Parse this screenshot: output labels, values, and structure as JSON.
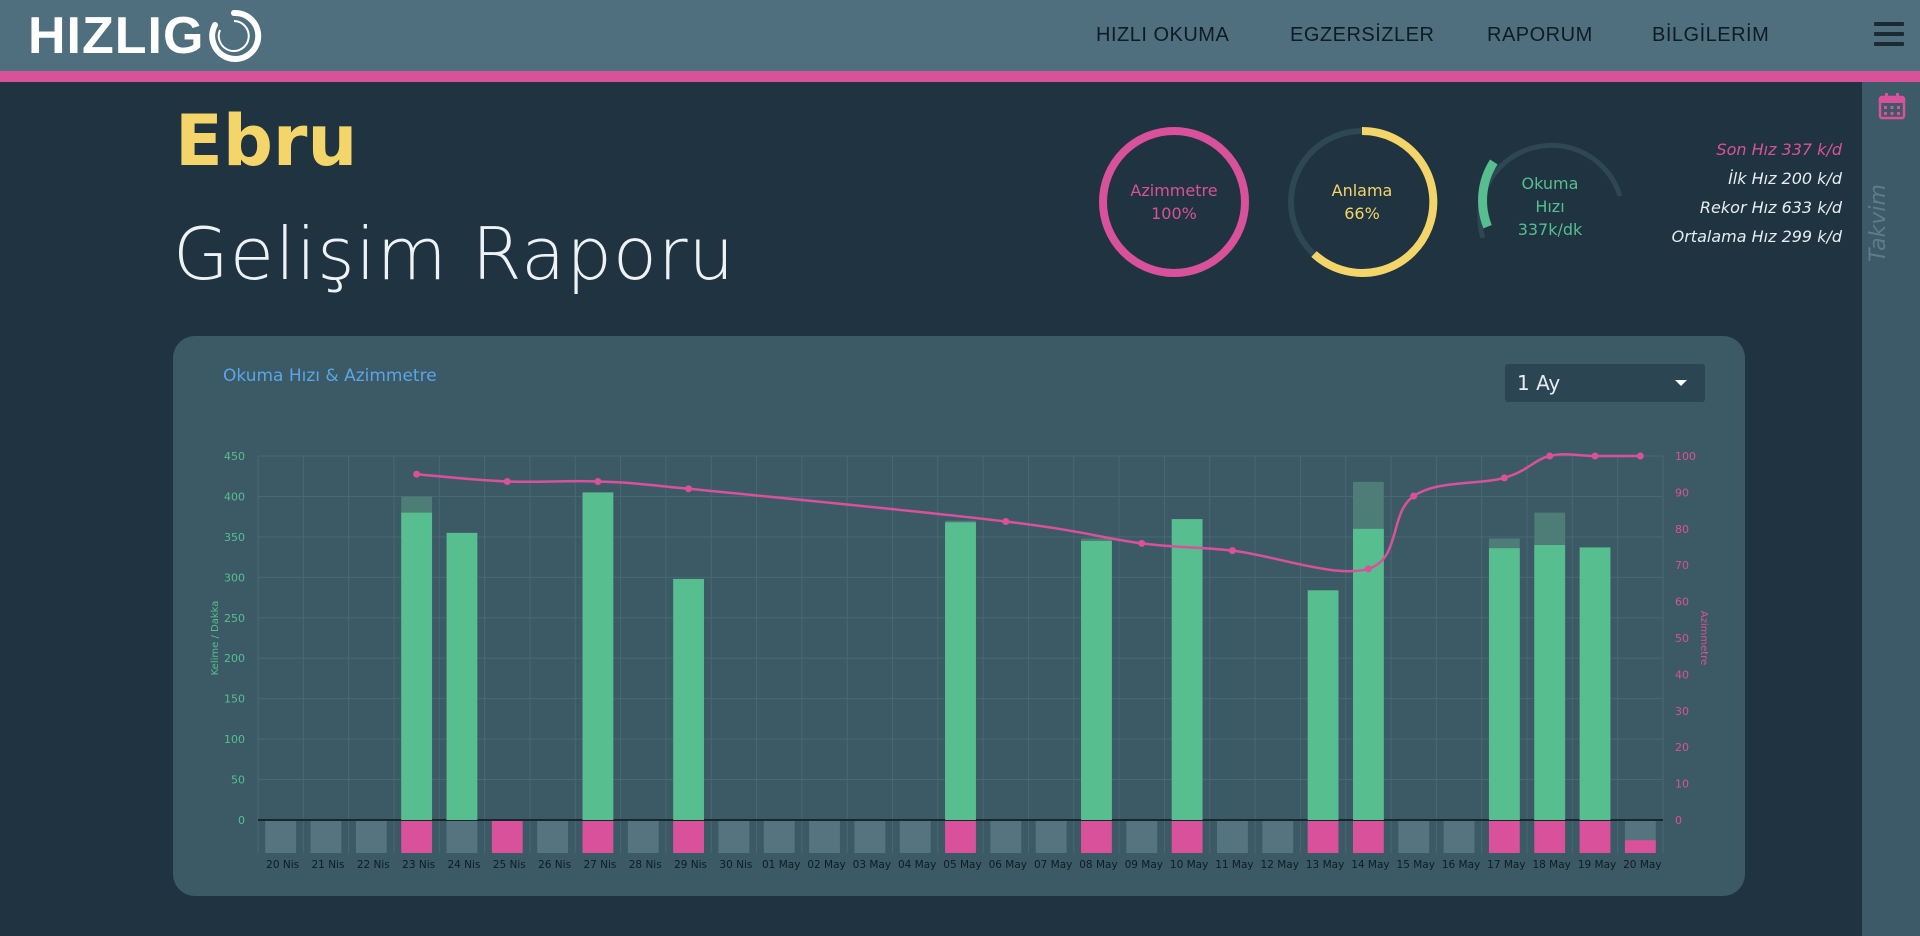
{
  "app": {
    "logo_text": "HIZLIG",
    "logo_mark": "O"
  },
  "nav": {
    "items": [
      "HIZLI OKUMA",
      "EGZERSİZLER",
      "RAPORUM",
      "BİLGİLERİM"
    ]
  },
  "side_panel": {
    "label": "Takvim"
  },
  "header": {
    "user_name": "Ebru",
    "title": "Gelişim Raporu"
  },
  "gauges": [
    {
      "label": "Azimmetre",
      "value_text": "100%",
      "value": 100,
      "color": "#d9519a"
    },
    {
      "label": "Anlama",
      "value_text": "66%",
      "value": 66,
      "color": "#f4d56a"
    },
    {
      "label_lines": [
        "Okuma",
        "Hızı"
      ],
      "value_text": "337k/dk",
      "value": 0.15,
      "color": "#57be8f"
    }
  ],
  "stats": [
    "Son Hız 337 k/d",
    "İlk Hız 200 k/d",
    "Rekor Hız 633 k/d",
    "Ortalama Hız 299 k/d"
  ],
  "chart_card": {
    "title": "Okuma Hızı & Azimmetre",
    "period": "1 Ay"
  },
  "colors": {
    "green": "#57be8f",
    "pink": "#d9519a",
    "yellow": "#f4d56a",
    "ghost": "#557480"
  },
  "chart_data": {
    "type": "bar",
    "categories": [
      "20 Nis",
      "21 Nis",
      "22 Nis",
      "23 Nis",
      "24 Nis",
      "25 Nis",
      "26 Nis",
      "27 Nis",
      "28 Nis",
      "29 Nis",
      "30 Nis",
      "01 May",
      "02 May",
      "03 May",
      "04 May",
      "05 May",
      "06 May",
      "07 May",
      "08 May",
      "09 May",
      "10 May",
      "11 May",
      "12 May",
      "13 May",
      "14 May",
      "15 May",
      "16 May",
      "17 May",
      "18 May",
      "19 May",
      "20 May"
    ],
    "ylabel": "Kelime / Dakka",
    "y2label": "Azimmetre",
    "ylim": [
      0,
      450
    ],
    "y2lim": [
      0,
      100
    ],
    "yticks": [
      0,
      50,
      100,
      150,
      200,
      250,
      300,
      350,
      400,
      450
    ],
    "y2ticks": [
      0,
      10,
      20,
      30,
      40,
      50,
      60,
      70,
      80,
      90,
      100
    ],
    "grid": true,
    "series": [
      {
        "type": "bar",
        "values": [
          0,
          0,
          0,
          380,
          355,
          0,
          0,
          405,
          0,
          298,
          0,
          0,
          0,
          0,
          0,
          368,
          0,
          0,
          345,
          0,
          372,
          0,
          0,
          284,
          360,
          0,
          0,
          336,
          340,
          337,
          0
        ]
      },
      {
        "type": "bar",
        "values": [
          0,
          0,
          0,
          400,
          0,
          0,
          0,
          0,
          0,
          0,
          0,
          0,
          0,
          0,
          0,
          370,
          0,
          0,
          348,
          0,
          0,
          0,
          0,
          0,
          418,
          0,
          0,
          348,
          380,
          0,
          0
        ]
      },
      {
        "type": "line",
        "axis": "y2",
        "values": [
          null,
          null,
          null,
          95,
          null,
          93,
          null,
          93,
          null,
          91,
          null,
          null,
          null,
          null,
          null,
          null,
          null,
          null,
          null,
          null,
          null,
          null,
          null,
          null,
          null,
          null,
          null,
          null,
          null,
          null,
          null
        ],
        "points": [
          [
            3,
            95
          ],
          [
            5,
            93
          ],
          [
            7,
            93
          ],
          [
            9,
            91
          ],
          [
            16,
            82
          ],
          [
            19,
            76
          ],
          [
            21,
            74
          ],
          [
            24,
            69
          ],
          [
            25,
            89
          ],
          [
            27,
            94
          ],
          [
            28,
            100
          ],
          [
            29,
            100
          ],
          [
            30,
            100
          ]
        ]
      },
      {
        "type": "bar",
        "values": [
          0,
          0,
          0,
          1,
          0,
          1,
          0,
          1,
          0,
          1,
          0,
          0,
          0,
          0,
          0,
          1,
          0,
          0,
          1,
          0,
          1,
          0,
          0,
          1,
          1,
          0,
          0,
          1,
          1,
          1,
          0.4
        ]
      }
    ]
  }
}
